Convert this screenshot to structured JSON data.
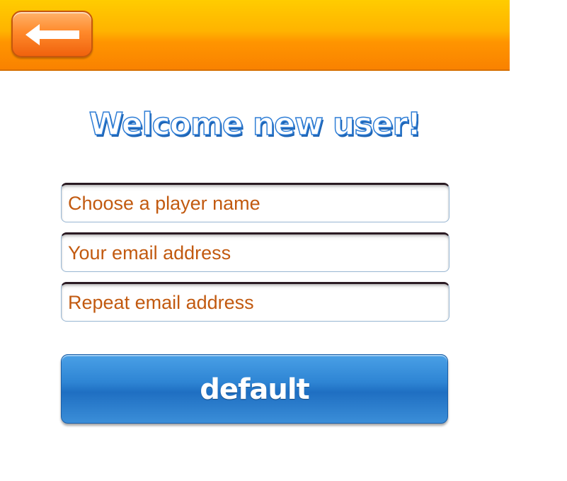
{
  "header": {
    "back_icon": "arrow-left-icon"
  },
  "title": "Welcome new user!",
  "form": {
    "player_name_placeholder": "Choose a player name",
    "email_placeholder": "Your email address",
    "repeat_email_placeholder": "Repeat email address",
    "submit_label": "default"
  },
  "colors": {
    "header_orange": "#ff9500",
    "field_text": "#c25a10",
    "button_blue": "#2e85d4",
    "title_blue": "#2f7ed6"
  }
}
